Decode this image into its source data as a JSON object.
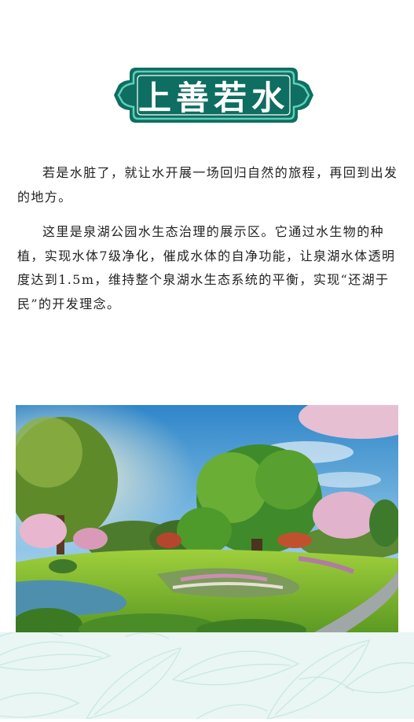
{
  "banner": {
    "title": "上善若水",
    "color": "#0d6e61",
    "accent": "#5fcfb7"
  },
  "paragraphs": [
    "若是水脏了，就让水开展一场回归自然的旅程，再回到出发的地方。",
    "这里是泉湖公园水生态治理的展示区。它通过水生物的种植，实现水体7级净化，催成水体的自净功能，让泉湖水体透明度达到1.5m，维持整个泉湖水生态系统的平衡，实现“还湖于民”的开发理念。"
  ],
  "photo": {
    "subject": "park-landscape-rendering"
  },
  "pattern": {
    "color": "#d7efec"
  }
}
